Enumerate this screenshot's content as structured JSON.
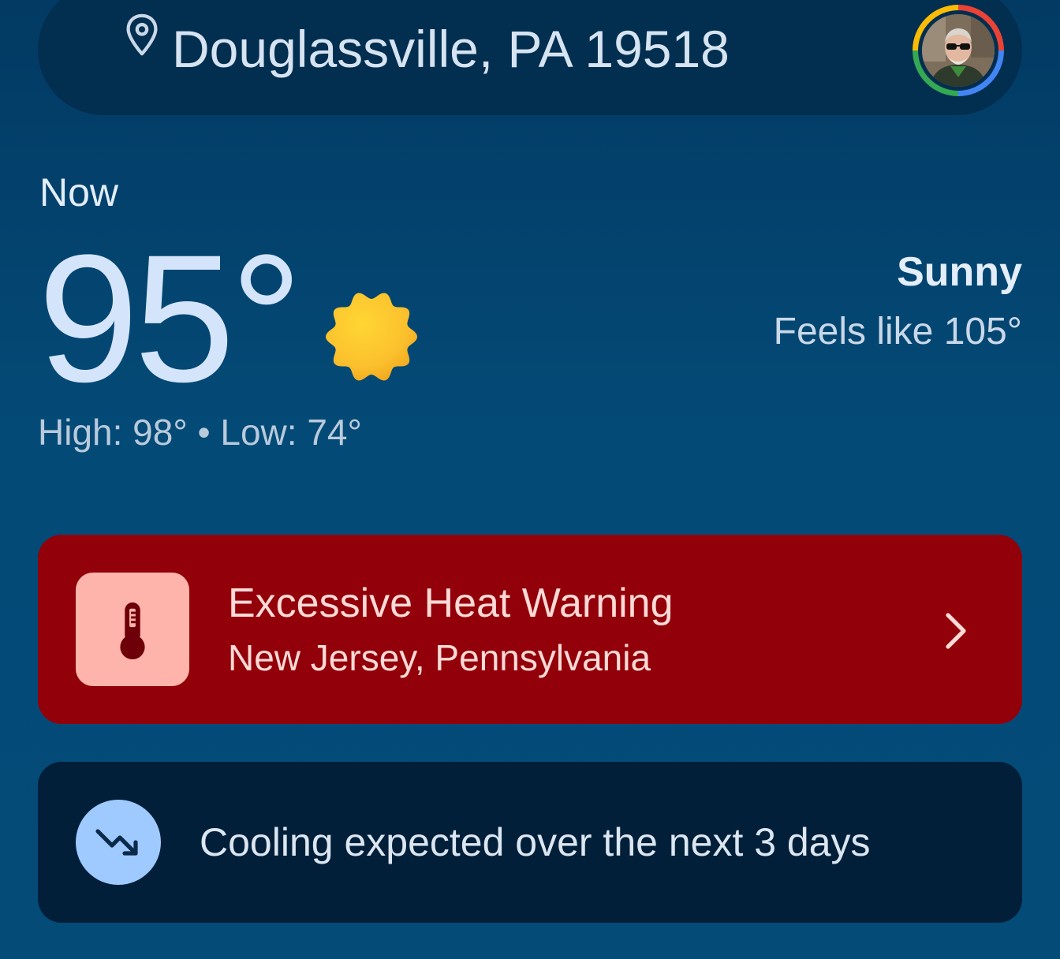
{
  "location": {
    "text": "Douglassville, PA 19518",
    "pin_icon": "location-pin-icon",
    "avatar": "account-avatar"
  },
  "current": {
    "label": "Now",
    "temperature": "95°",
    "condition": "Sunny",
    "feels_like": "Feels like 105°",
    "high_low": "High: 98° • Low: 74°",
    "condition_icon": "sun-icon"
  },
  "alert": {
    "title": "Excessive Heat Warning",
    "regions": "New Jersey, Pennsylvania",
    "icon": "thermometer-icon",
    "colors": {
      "background": "#92000a",
      "icon_background": "#ffb4ab",
      "text": "#ffdad6"
    }
  },
  "trend": {
    "text": "Cooling expected over the next 3 days",
    "icon": "trending-down-icon"
  },
  "colors": {
    "page_background": "#044a77",
    "location_bar": "#022e50",
    "trend_card": "#011f39",
    "sun": "#fbc02d",
    "temperature_text": "#d4e5fb"
  }
}
